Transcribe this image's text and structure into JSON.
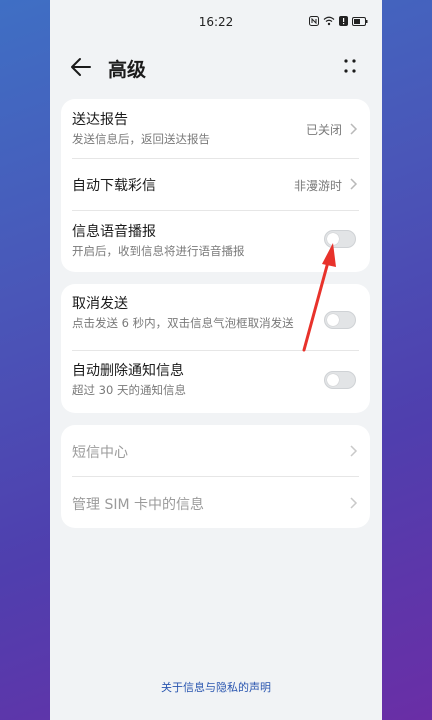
{
  "status_bar": {
    "time": "16:22"
  },
  "header": {
    "title": "高级"
  },
  "card1": {
    "delivery_report": {
      "title": "送达报告",
      "subtitle": "发送信息后，返回送达报告",
      "value": "已关闭"
    },
    "auto_download_mms": {
      "title": "自动下载彩信",
      "value": "非漫游时"
    },
    "voice_broadcast": {
      "title": "信息语音播报",
      "subtitle": "开启后，收到信息将进行语音播报",
      "enabled": false
    }
  },
  "card2": {
    "undo_send": {
      "title": "取消发送",
      "subtitle": "点击发送 6 秒内，双击信息气泡框取消发送",
      "enabled": false
    },
    "auto_delete_notifications": {
      "title": "自动删除通知信息",
      "subtitle": "超过 30 天的通知信息",
      "enabled": false
    }
  },
  "card3": {
    "sms_center": {
      "title": "短信中心"
    },
    "manage_sim": {
      "title": "管理 SIM 卡中的信息"
    }
  },
  "footer": {
    "link": "关于信息与隐私的声明"
  },
  "colors": {
    "accent_link": "#2a56b0",
    "annotation_arrow": "#e8322b"
  },
  "icons": [
    "nfc-icon",
    "wifi-icon",
    "alert-icon",
    "battery-icon",
    "back-arrow-icon",
    "more-icon",
    "chevron-right-icon"
  ]
}
